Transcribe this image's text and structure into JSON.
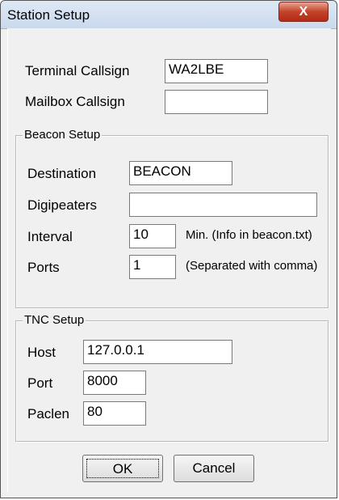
{
  "window": {
    "title": "Station Setup",
    "close_symbol": "X"
  },
  "station": {
    "terminal_callsign_label": "Terminal Callsign",
    "terminal_callsign_value": "WA2LBE",
    "mailbox_callsign_label": "Mailbox Callsign",
    "mailbox_callsign_value": ""
  },
  "beacon": {
    "group_title": "Beacon Setup",
    "destination_label": "Destination",
    "destination_value": "BEACON",
    "digipeaters_label": "Digipeaters",
    "digipeaters_value": "",
    "interval_label": "Interval",
    "interval_value": "10",
    "interval_hint": "Min.  (Info in beacon.txt)",
    "ports_label": "Ports",
    "ports_value": "1",
    "ports_hint": "(Separated with comma)"
  },
  "tnc": {
    "group_title": "TNC Setup",
    "host_label": "Host",
    "host_value": "127.0.0.1",
    "port_label": "Port",
    "port_value": "8000",
    "paclen_label": "Paclen",
    "paclen_value": "80"
  },
  "buttons": {
    "ok_label": "OK",
    "cancel_label": "Cancel"
  },
  "colors": {
    "window_bg": "#f0f0f0",
    "titlebar": "#d2e0f0",
    "close_button": "#c4432a"
  },
  "icons": {
    "close": "close-icon"
  }
}
